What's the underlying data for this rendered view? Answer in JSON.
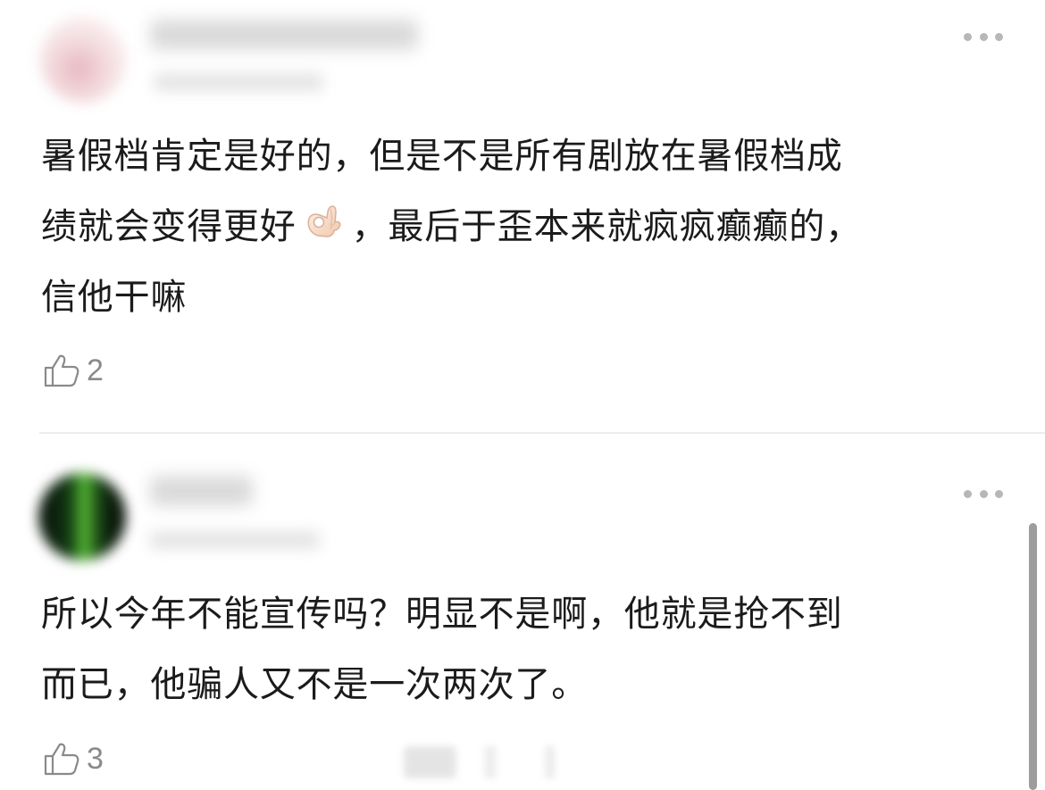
{
  "comments": [
    {
      "lines": [
        "暑假档肯定是好的，但是不是所有剧放在暑假档成",
        "绩就会变得更好",
        "，最后于歪本来就疯疯癫癫的，",
        "信他干嘛"
      ],
      "emoji": "ok-hand-emoji",
      "likes": "2"
    },
    {
      "lines": [
        "所以今年不能宣传吗？明显不是啊，他就是抢不到",
        "而已，他骗人又不是一次两次了。"
      ],
      "likes": "3"
    }
  ],
  "icons": {
    "like": "thumbs-up-icon",
    "more": "more-options-icon"
  },
  "colors": {
    "text": "#1b1b1b",
    "muted": "#8a8a8a",
    "icon": "#8a8a8a",
    "divider": "#ececec"
  }
}
